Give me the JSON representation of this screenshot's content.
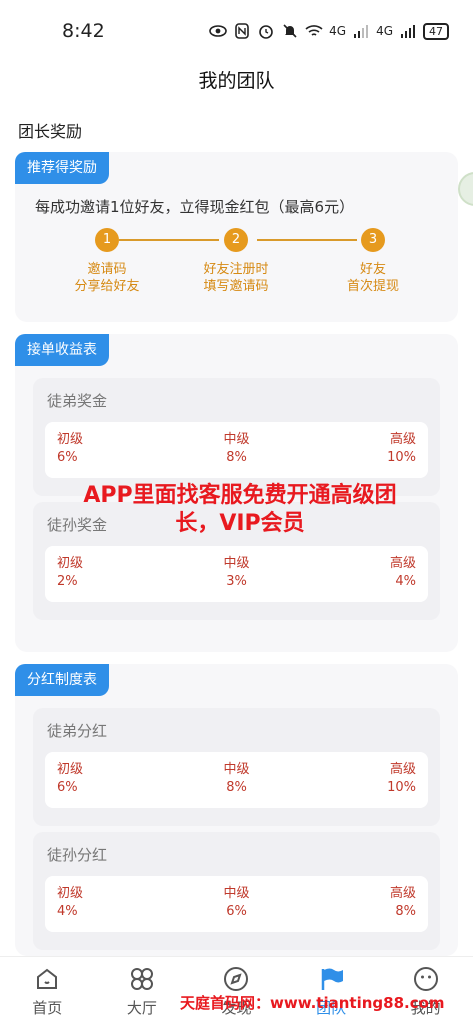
{
  "status_bar": {
    "time": "8:42",
    "network_1": "4G",
    "network_2": "4G",
    "battery": "47"
  },
  "nav": {
    "title": "我的团队"
  },
  "section": {
    "heading": "团长奖励"
  },
  "invite_card": {
    "tag": "推荐得奖励",
    "description": "每成功邀请1位好友，立得现金红包（最高6元）",
    "steps": [
      {
        "num": "1",
        "line1": "邀请码",
        "line2": "分享给好友"
      },
      {
        "num": "2",
        "line1": "好友注册时",
        "line2": "填写邀请码"
      },
      {
        "num": "3",
        "line1": "好友",
        "line2": "首次提现"
      }
    ]
  },
  "income_card": {
    "tag": "接单收益表",
    "groups": [
      {
        "title": "徒弟奖金",
        "levels": [
          {
            "name": "初级",
            "value": "6%"
          },
          {
            "name": "中级",
            "value": "8%"
          },
          {
            "name": "高级",
            "value": "10%"
          }
        ]
      },
      {
        "title": "徒孙奖金",
        "levels": [
          {
            "name": "初级",
            "value": "2%"
          },
          {
            "name": "中级",
            "value": "3%"
          },
          {
            "name": "高级",
            "value": "4%"
          }
        ]
      }
    ]
  },
  "dividend_card": {
    "tag": "分红制度表",
    "groups": [
      {
        "title": "徒弟分红",
        "levels": [
          {
            "name": "初级",
            "value": "6%"
          },
          {
            "name": "中级",
            "value": "8%"
          },
          {
            "name": "高级",
            "value": "10%"
          }
        ]
      },
      {
        "title": "徒孙分红",
        "levels": [
          {
            "name": "初级",
            "value": "4%"
          },
          {
            "name": "中级",
            "value": "6%"
          },
          {
            "name": "高级",
            "value": "8%"
          }
        ]
      }
    ]
  },
  "overlay": {
    "line1": "APP里面找客服免费开通高级团",
    "line2": "长，VIP会员"
  },
  "tabs": [
    {
      "label": "首页",
      "icon": "home-icon"
    },
    {
      "label": "大厅",
      "icon": "grid-icon"
    },
    {
      "label": "发现",
      "icon": "compass-icon"
    },
    {
      "label": "团队",
      "icon": "flag-icon"
    },
    {
      "label": "我的",
      "icon": "face-icon"
    }
  ],
  "watermark": {
    "text": "天庭首码网：www.tianting88.com"
  },
  "colors": {
    "accent": "#2f8fe8",
    "step": "#e69a1e",
    "level": "#c0392b",
    "overlay": "#e8191f"
  }
}
